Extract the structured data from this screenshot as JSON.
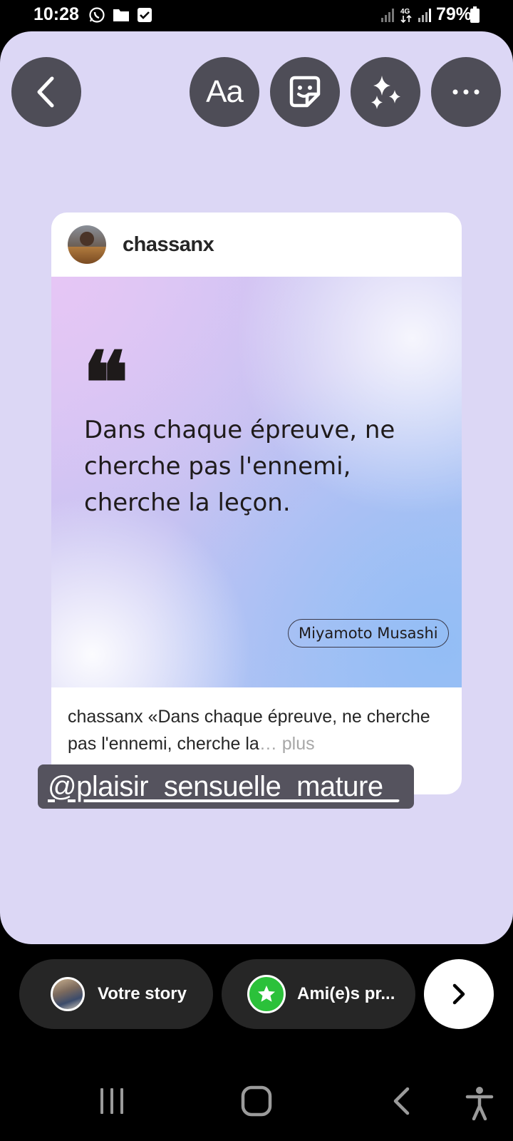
{
  "status_bar": {
    "time": "10:28",
    "battery": "79%",
    "left_icons": [
      "whatsapp-icon",
      "folder-icon",
      "checkbox-icon"
    ],
    "right_icons": [
      "signal-icon",
      "4g-icon",
      "signal-icon"
    ]
  },
  "toolbar": {
    "back_icon": "chevron-left-icon",
    "text_label": "Aa",
    "sticker_icon": "sticker-icon",
    "effects_icon": "sparkles-icon",
    "more_icon": "more-horizontal-icon"
  },
  "post": {
    "username": "chassanx",
    "quote_mark": "❝",
    "quote_lines": [
      "Dans chaque épreuve, ne",
      "cherche pas l'ennemi,",
      "cherche la leçon."
    ],
    "author": "Miyamoto Musashi",
    "caption_user": "chassanx",
    "caption_text": " «Dans chaque épreuve, ne cherche pas l'ennemi, cherche la",
    "caption_ellipsis": "…",
    "caption_more": " plus"
  },
  "mention": {
    "text": "@plaisir_sensuelle_mature_"
  },
  "share": {
    "your_story_label": "Votre story",
    "close_friends_label": "Ami(e)s pr...",
    "close_friends_color": "#2bc13a",
    "next_icon": "chevron-right-icon"
  },
  "nav": {
    "icons": [
      "recents-icon",
      "home-icon",
      "back-icon",
      "accessibility-icon"
    ]
  }
}
